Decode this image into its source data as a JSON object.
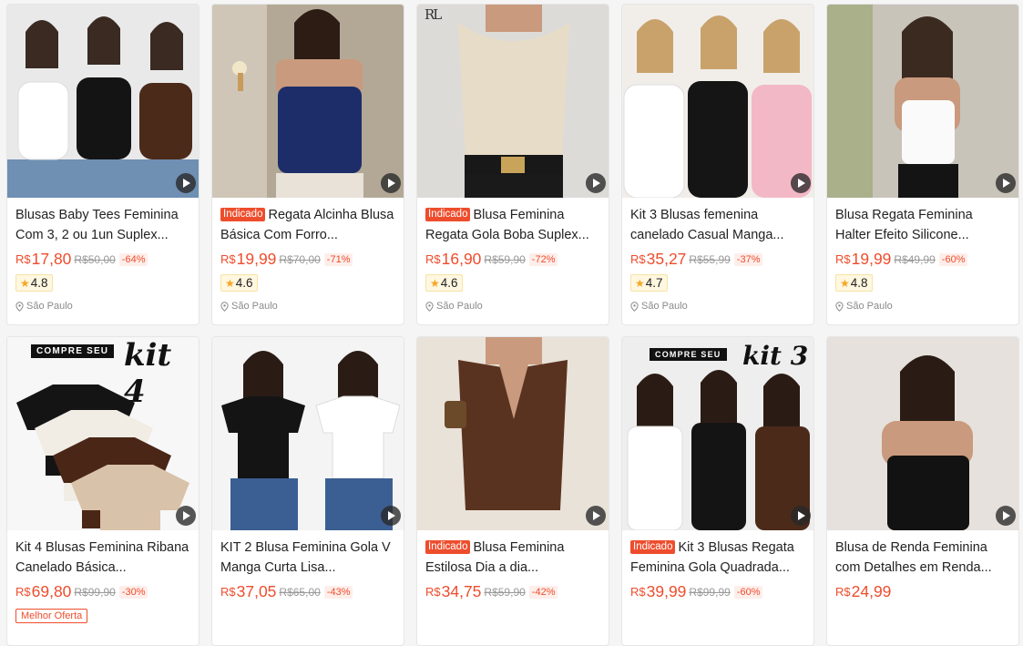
{
  "currency": "R$",
  "products": [
    {
      "title": "Blusas Baby Tees Feminina Com 3, 2 ou 1un Suplex...",
      "badge": "",
      "price": "17,80",
      "original": "R$50,00",
      "discount": "-64%",
      "rating": "4.8",
      "location": "São Paulo",
      "icon": "play-icon"
    },
    {
      "title": "Regata Alcinha Blusa Básica Com Forro...",
      "badge": "Indicado",
      "price": "19,99",
      "original": "R$70,00",
      "discount": "-71%",
      "rating": "4.6",
      "location": "São Paulo",
      "icon": "play-icon"
    },
    {
      "title": "Blusa Feminina Regata Gola Boba Suplex...",
      "badge": "Indicado",
      "price": "16,90",
      "original": "R$59,90",
      "discount": "-72%",
      "rating": "4.6",
      "location": "São Paulo",
      "icon": "play-icon",
      "logo": "RL"
    },
    {
      "title": "Kit 3 Blusas femenina canelado Casual Manga...",
      "badge": "",
      "price": "35,27",
      "original": "R$55,99",
      "discount": "-37%",
      "rating": "4.7",
      "location": "São Paulo",
      "icon": "play-icon"
    },
    {
      "title": "Blusa Regata Feminina Halter Efeito Silicone...",
      "badge": "",
      "price": "19,99",
      "original": "R$49,99",
      "discount": "-60%",
      "rating": "4.8",
      "location": "São Paulo",
      "icon": "play-icon"
    },
    {
      "title": "Kit 4 Blusas Feminina Ribana Canelado Básica...",
      "badge": "",
      "price": "69,80",
      "original": "R$99,90",
      "discount": "-30%",
      "tag": "Melhor Oferta",
      "banner": "COMPRE SEU",
      "kit": "kit 4",
      "icon": "play-icon"
    },
    {
      "title": "KIT 2 Blusa Feminina Gola V Manga Curta Lisa...",
      "badge": "",
      "price": "37,05",
      "original": "R$65,00",
      "discount": "-43%",
      "icon": "play-icon"
    },
    {
      "title": "Blusa Feminina Estilosa Dia a dia...",
      "badge": "Indicado",
      "price": "34,75",
      "original": "R$59,90",
      "discount": "-42%",
      "icon": "play-icon"
    },
    {
      "title": "Kit 3 Blusas Regata Feminina Gola Quadrada...",
      "badge": "Indicado",
      "price": "39,99",
      "original": "R$99,99",
      "discount": "-60%",
      "banner": "COMPRE SEU",
      "kit": "kit 3",
      "icon": "play-icon"
    },
    {
      "title": "Blusa de Renda Feminina com Detalhes em Renda...",
      "badge": "",
      "price": "24,99",
      "original": "",
      "discount": "",
      "icon": "play-icon"
    }
  ],
  "colors": {
    "accent": "#ee4d2d",
    "star": "#f5a623"
  }
}
